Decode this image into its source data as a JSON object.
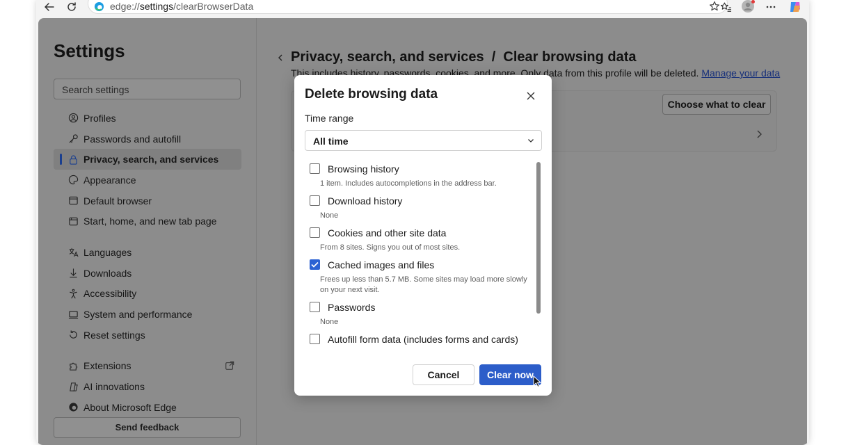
{
  "browser": {
    "url_prefix": "edge://",
    "url_bold": "settings",
    "url_suffix": "/clearBrowserData"
  },
  "sidebar": {
    "title": "Settings",
    "search_placeholder": "Search settings",
    "items_group1": [
      {
        "label": "Profiles",
        "icon": "profiles-icon"
      },
      {
        "label": "Passwords and autofill",
        "icon": "key-icon"
      },
      {
        "label": "Privacy, search, and services",
        "icon": "lock-icon",
        "active": true
      },
      {
        "label": "Appearance",
        "icon": "appearance-icon"
      },
      {
        "label": "Default browser",
        "icon": "browser-icon"
      },
      {
        "label": "Start, home, and new tab page",
        "icon": "home-icon"
      }
    ],
    "items_group2": [
      {
        "label": "Languages",
        "icon": "languages-icon"
      },
      {
        "label": "Downloads",
        "icon": "download-icon"
      },
      {
        "label": "Accessibility",
        "icon": "accessibility-icon"
      },
      {
        "label": "System and performance",
        "icon": "system-icon"
      },
      {
        "label": "Reset settings",
        "icon": "reset-icon"
      }
    ],
    "items_group3": [
      {
        "label": "Extensions",
        "icon": "extensions-icon"
      },
      {
        "label": "AI innovations",
        "icon": "ai-icon"
      },
      {
        "label": "About Microsoft Edge",
        "icon": "edge-icon"
      }
    ],
    "feedback_label": "Send feedback"
  },
  "main": {
    "breadcrumb": "Privacy, search, and services  /  Clear browsing data",
    "description": "This includes history, passwords, cookies, and more. Only data from this profile will be deleted.",
    "manage_link": "Manage your data",
    "choose_button": "Choose what to clear"
  },
  "dialog": {
    "title": "Delete browsing data",
    "time_range_label": "Time range",
    "time_range_value": "All time",
    "options": [
      {
        "label": "Browsing history",
        "desc": "1 item. Includes autocompletions in the address bar.",
        "checked": false
      },
      {
        "label": "Download history",
        "desc": "None",
        "checked": false
      },
      {
        "label": "Cookies and other site data",
        "desc": "From 8 sites. Signs you out of most sites.",
        "checked": false
      },
      {
        "label": "Cached images and files",
        "desc": "Frees up less than 5.7 MB. Some sites may load more slowly on your next visit.",
        "checked": true
      },
      {
        "label": "Passwords",
        "desc": "None",
        "checked": false
      },
      {
        "label": "Autofill form data (includes forms and cards)",
        "desc": "",
        "checked": false
      }
    ],
    "cancel_label": "Cancel",
    "clear_label": "Clear now"
  },
  "colors": {
    "accent": "#2c5dc9",
    "checkbox_checked": "#2b62d3",
    "link": "#17307a"
  }
}
